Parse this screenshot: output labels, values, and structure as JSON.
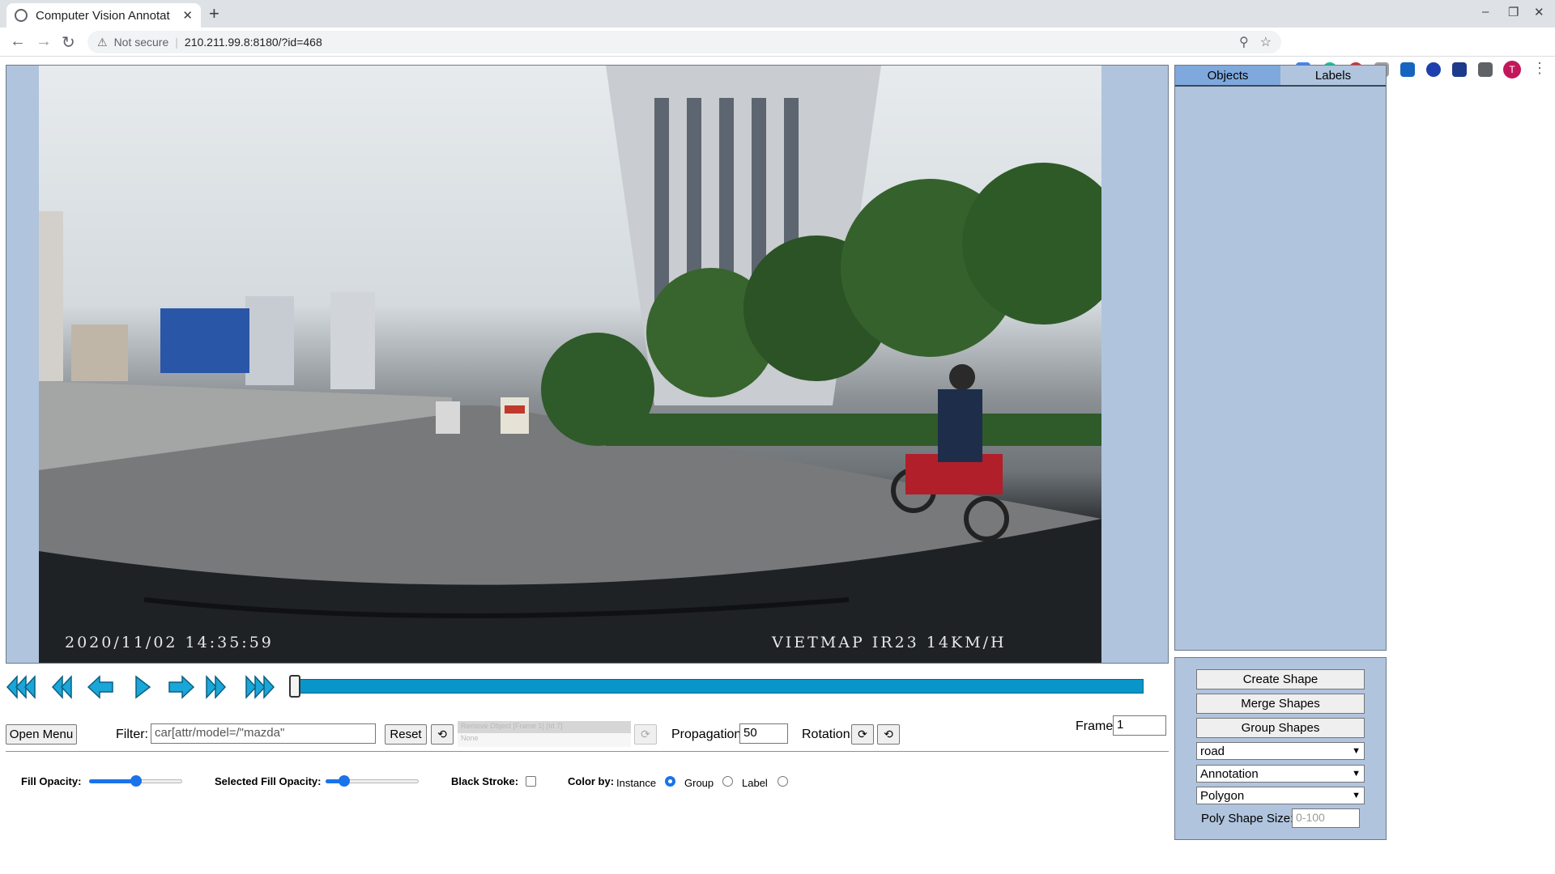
{
  "browser": {
    "tab_title": "Computer Vision Annotat",
    "tab_close": "✕",
    "new_tab": "+",
    "security_label": "Not secure",
    "url": "210.211.99.8:8180/?id=468",
    "avatar_letter": "T"
  },
  "video": {
    "timestamp": "2020/11/02  14:35:59",
    "camera_info": "VIETMAP IR23  14KM/H"
  },
  "side_panel": {
    "tabs": [
      "Objects",
      "Labels"
    ]
  },
  "tools": {
    "create_shape": "Create Shape",
    "merge_shapes": "Merge Shapes",
    "group_shapes": "Group Shapes",
    "label_select": "road",
    "mode_select": "Annotation",
    "shape_select": "Polygon",
    "poly_size_label": "Poly Shape Size:",
    "poly_size_placeholder": "0-100"
  },
  "controls": {
    "open_menu": "Open Menu",
    "filter_label": "Filter:",
    "filter_value": "car[attr/model=/\"mazda\"",
    "reset": "Reset",
    "remove_object_option": "Remove Object [Frame 1] [Id 7]",
    "remove_object_none": "None",
    "propagation_label": "Propagation",
    "propagation_value": "50",
    "rotation_label": "Rotation",
    "frame_label": "Frame",
    "frame_value": "1"
  },
  "display": {
    "fill_opacity_label": "Fill Opacity:",
    "fill_opacity_value": 0.5,
    "selected_fill_opacity_label": "Selected Fill Opacity:",
    "selected_fill_opacity_value": 0.2,
    "black_stroke_label": "Black Stroke:",
    "color_by_label": "Color by:",
    "color_by_options": [
      "Instance",
      "Group",
      "Label"
    ],
    "color_by_selected": "Instance"
  },
  "colors": {
    "panel_bg": "#b0c4de",
    "active_tab": "#7fa8dc",
    "accent": "#0895c9"
  }
}
